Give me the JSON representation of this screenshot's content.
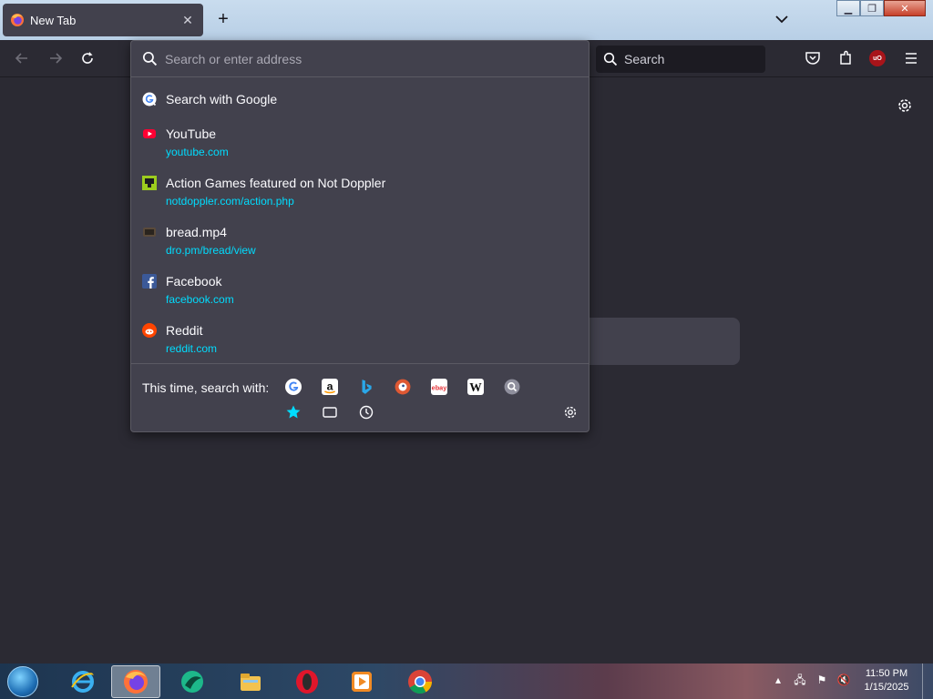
{
  "browser": {
    "tab_title": "New Tab",
    "new_tab_symbol": "+",
    "close_tab_symbol": "✕",
    "toolbar_search_placeholder": "Search",
    "ublock_badge": "uO"
  },
  "urlbar": {
    "placeholder": "Search or enter address",
    "results": [
      {
        "title": "Search with Google",
        "url": "",
        "icon": "google-icon"
      },
      {
        "title": "YouTube",
        "url": "youtube.com",
        "icon": "youtube-icon"
      },
      {
        "title": "Action Games featured on Not Doppler",
        "url": "notdoppler.com/action.php",
        "icon": "notdoppler-icon"
      },
      {
        "title": "bread.mp4",
        "url": "dro.pm/bread/view",
        "icon": "bread-icon"
      },
      {
        "title": "Facebook",
        "url": "facebook.com",
        "icon": "facebook-icon"
      },
      {
        "title": "Reddit",
        "url": "reddit.com",
        "icon": "reddit-icon"
      }
    ],
    "oneoff_label": "This time, search with:",
    "engines": [
      "google-icon",
      "amazon-icon",
      "bing-icon",
      "duckduckgo-icon",
      "ebay-icon",
      "wikipedia-icon",
      "search-engine-icon"
    ],
    "modes": [
      "bookmarks-star-icon",
      "tabs-icon",
      "history-clock-icon"
    ]
  },
  "taskbar": {
    "clock_time": "11:50 PM",
    "clock_date": "1/15/2025",
    "apps": [
      "internet-explorer-icon",
      "firefox-icon",
      "app-icon",
      "file-explorer-icon",
      "opera-icon",
      "media-player-icon",
      "chrome-icon"
    ]
  },
  "colors": {
    "accent_url": "#00ddff",
    "popup_bg": "#42414d",
    "page_bg": "#2b2a33"
  }
}
